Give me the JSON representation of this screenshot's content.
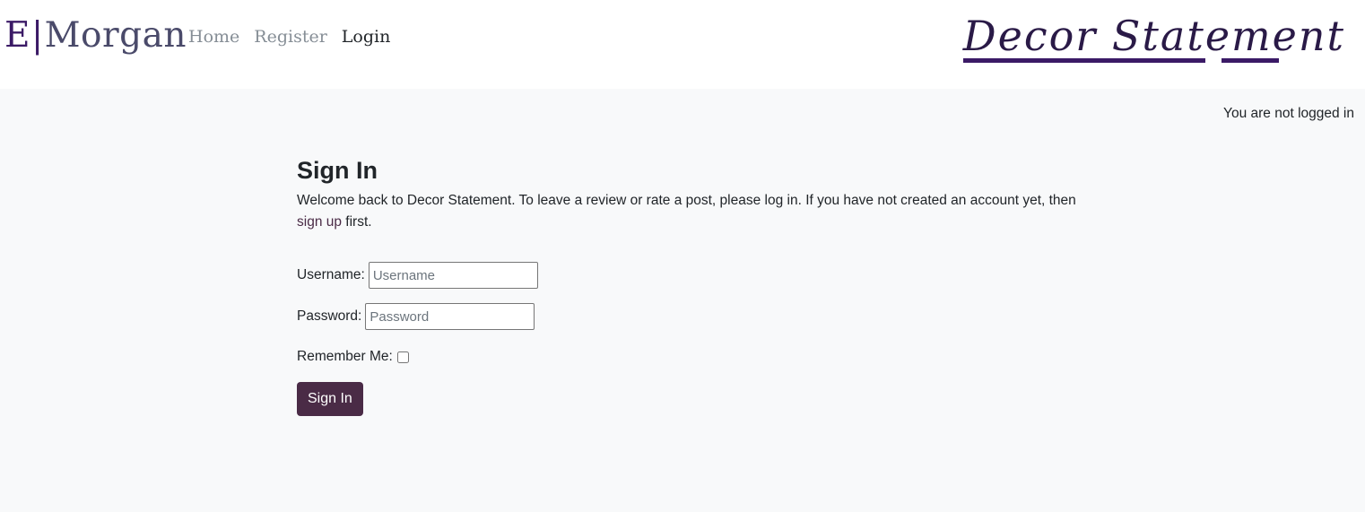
{
  "brand": {
    "initial": "E",
    "separator": "|",
    "name": "Morgan"
  },
  "nav": {
    "items": [
      {
        "label": "Home"
      },
      {
        "label": "Register"
      },
      {
        "label": "Login"
      }
    ]
  },
  "logo": {
    "text": "Decor Statement"
  },
  "status_text": "You are not logged in",
  "signin": {
    "title": "Sign In",
    "intro_before": "Welcome back to Decor Statement. To leave a review or rate a post, please log in. If you have not created an account yet, then ",
    "intro_link": "sign up",
    "intro_after": " first.",
    "username_label": "Username:",
    "username_placeholder": "Username",
    "username_value": "",
    "password_label": "Password:",
    "password_placeholder": "Password",
    "password_value": "",
    "remember_label": "Remember Me:",
    "remember_checked": false,
    "submit_label": "Sign In"
  },
  "colors": {
    "accent": "#4a2b46",
    "brand_purple": "#3b1a66",
    "page_bg": "#f8f9fa"
  }
}
